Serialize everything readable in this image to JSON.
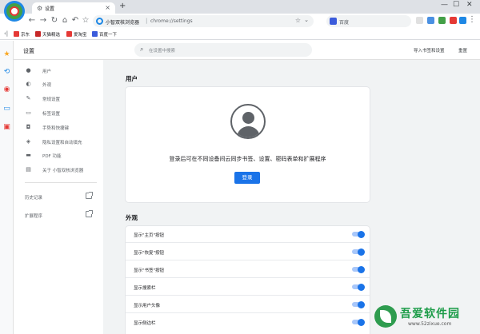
{
  "browser": {
    "tab_title": "设置",
    "new_tab": "+",
    "site_name": "小智双核浏览器",
    "url": "chrome://settings",
    "search_engine_label": "百度",
    "window_controls": [
      "—",
      "☐",
      "✕"
    ]
  },
  "bookmarks": [
    {
      "label": "京东",
      "color": "#e53935"
    },
    {
      "label": "天猫精选",
      "color": "#c62828"
    },
    {
      "label": "爱淘宝",
      "color": "#e53935"
    },
    {
      "label": "百度一下",
      "color": "#3b5bdb"
    }
  ],
  "settings": {
    "title": "设置",
    "search_placeholder": "在设置中搜索",
    "import_link": "导入书签和设置",
    "reset_link": "重置"
  },
  "sidenav": {
    "items": [
      {
        "label": "用户",
        "icon": "person-icon"
      },
      {
        "label": "外观",
        "icon": "palette-icon"
      },
      {
        "label": "常规设置",
        "icon": "wrench-icon"
      },
      {
        "label": "标签设置",
        "icon": "tab-icon"
      },
      {
        "label": "手势和快捷键",
        "icon": "mouse-icon"
      },
      {
        "label": "隐私设置和自动填充",
        "icon": "shield-icon"
      },
      {
        "label": "PDF 功能",
        "icon": "pdf-icon"
      },
      {
        "label": "关于 小智双核浏览器",
        "icon": "info-icon"
      }
    ],
    "external": [
      {
        "label": "历史记录"
      },
      {
        "label": "扩展程序"
      }
    ]
  },
  "main": {
    "user_section": {
      "title": "用户",
      "signin_text": "登录后可在不同设备间云同步书签、设置、密码表单和扩展程序",
      "signin_button": "登录"
    },
    "appearance_section": {
      "title": "外观",
      "rows": [
        {
          "label": "显示\"主页\"按钮",
          "on": true
        },
        {
          "label": "显示\"恢复\"按钮",
          "on": true
        },
        {
          "label": "显示\"书签\"按钮",
          "on": true
        },
        {
          "label": "显示搜索栏",
          "on": true
        },
        {
          "label": "显示用户头像",
          "on": true
        },
        {
          "label": "显示侧边栏",
          "on": true
        }
      ]
    }
  },
  "watermark": {
    "title": "吾爱软件园",
    "url": "www.52zixue.com"
  },
  "colors": {
    "accent": "#1a73e8",
    "toggle_track": "#a8c7fa",
    "main_bg": "#f1f3f4"
  }
}
